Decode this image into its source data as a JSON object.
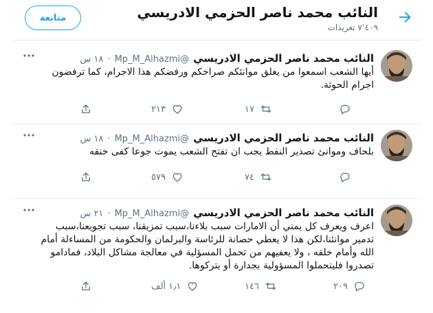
{
  "header": {
    "title": "النائب محمد ناصر الحزمي الادريسي",
    "tweet_count": "٧٬٤٠٩ تغريدات",
    "follow_label": "متابعة"
  },
  "tweets": [
    {
      "name": "النائب محمد ناصر الحزمي الادريسي",
      "handle": "@Mp_M_Alhazmi",
      "time": "١٨ س",
      "text": "أيها الشعب اسمعوا من يغلق موانئكم صراخكم ورفضكم هذا الاجرام، كما ترفضون اجرام الحوثة.",
      "replies": "",
      "retweets": "١٧",
      "likes": "٢١٣"
    },
    {
      "name": "النائب محمد ناصر الحزمي الادريسي",
      "handle": "@Mp_M_Alhazmi",
      "time": "١٨ س",
      "text": "بلحاف وموانئ تصدير النفط يجب ان تفتح الشعب يموت جوعا كفى خنقه",
      "replies": "",
      "retweets": "٧٤",
      "likes": "٥٧٩"
    },
    {
      "name": "النائب محمد ناصر الحزمي الادريسي",
      "handle": "@Mp_M_Alhazmi",
      "time": "٢١ س",
      "text": "اعرف ويعرف كل يمني  أن الامارات سبب بلاءنا،سبب تمزيقنا، سبب تجويعنا،سبب تدمير موانئنا،لكن هذا لا يعطي حصانة للرئاسة والبرلمان والحكومة من المساءلة أمام الله وأمام خلقه ، ولا يعفيهم من تحمل المسؤلية في معالجة مشاكل البلاد، فمادامو تصدروا فليتحملوا المسؤولية بجدارة أو يتركوها.",
      "replies": "٢٠٩",
      "retweets": "١٤٦",
      "likes": "١٫١ ألف"
    }
  ]
}
